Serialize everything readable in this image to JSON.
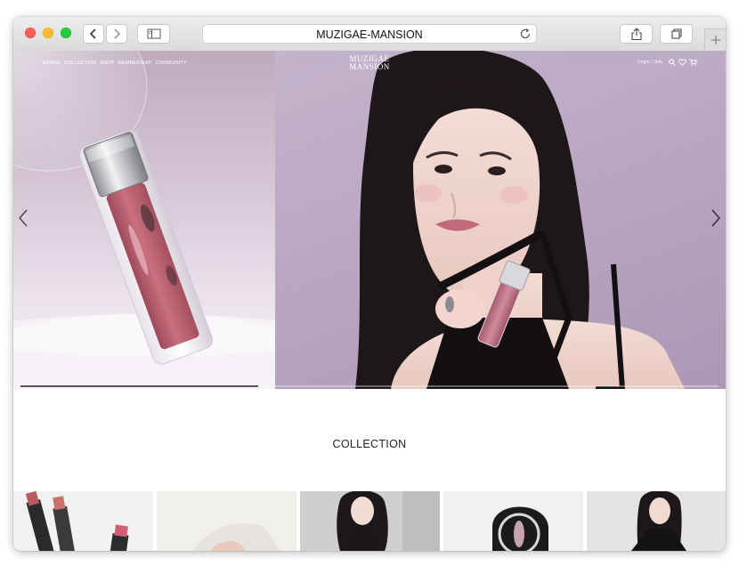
{
  "browser": {
    "url": "MUZIGAE-MANSION",
    "buttons": {
      "back": "chevron-left-icon",
      "forward": "chevron-right-icon",
      "sidebar": "sidebar-icon",
      "reload": "reload-icon",
      "share": "share-icon",
      "tabs": "tabs-icon",
      "new_tab": "plus-icon"
    },
    "traffic_lights": {
      "close": "#ff5f57",
      "minimize": "#febc2e",
      "zoom": "#28c840"
    }
  },
  "site": {
    "nav": [
      "BRAND",
      "COLLECTION",
      "SHOP",
      "MEMBERSHIP",
      "COMMUNITY"
    ],
    "logo": [
      "MUZIGAE",
      "MANSION"
    ],
    "login": "Login / Join",
    "icons": [
      "search-icon",
      "heart-icon",
      "cart-icon"
    ]
  },
  "hero": {
    "prev": "chevron-left-icon",
    "next": "chevron-right-icon",
    "progress": 0.34
  },
  "collection": {
    "title": "COLLECTION"
  },
  "colors": {
    "accent_lavender": "#b9a5c1",
    "product_rose": "#b8616e"
  }
}
